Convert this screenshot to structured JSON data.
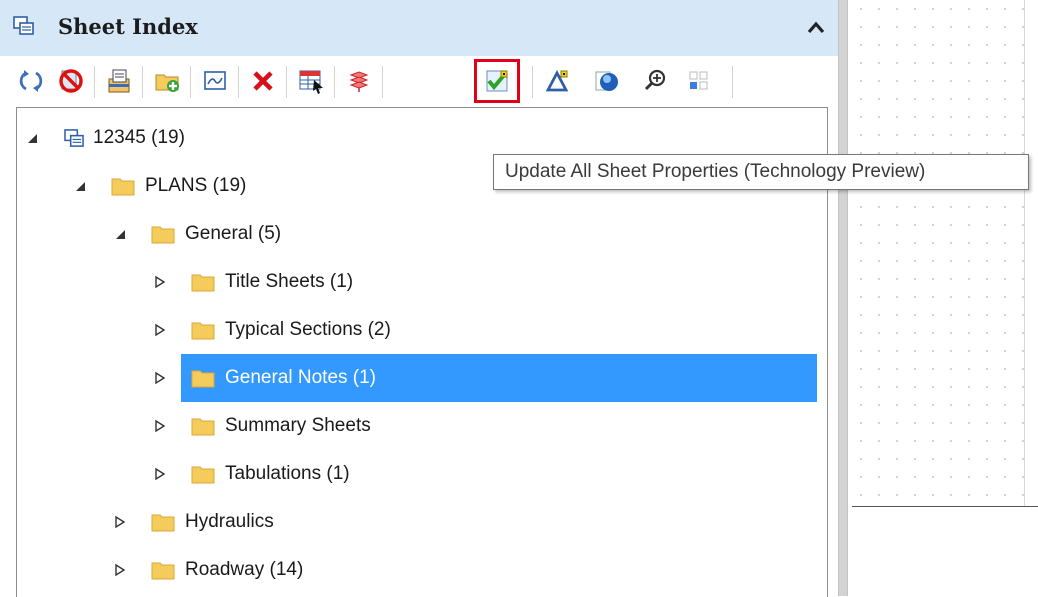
{
  "panel": {
    "title": "Sheet Index",
    "header_icon": "sheet-index-icon",
    "collapse_icon": "chevron-up-icon"
  },
  "toolbar": {
    "buttons": [
      {
        "name": "refresh-icon"
      },
      {
        "name": "no-entry-icon"
      },
      {
        "name": "sheet-stack-icon"
      },
      {
        "name": "add-folder-icon"
      },
      {
        "name": "sheet-image-icon"
      },
      {
        "name": "delete-icon"
      },
      {
        "name": "table-select-icon"
      },
      {
        "name": "layers-icon"
      },
      {
        "name": "update-properties-icon",
        "active": true
      },
      {
        "name": "triangle-icon"
      },
      {
        "name": "globe-icon"
      },
      {
        "name": "zoom-icon"
      },
      {
        "name": "grid-icon"
      }
    ]
  },
  "tooltip": {
    "text": "Update All Sheet Properties (Technology Preview)"
  },
  "tree": {
    "root": "12345 (19)",
    "plans": "PLANS (19)",
    "general": "General (5)",
    "title_sheets": "Title Sheets (1)",
    "typical_sections": "Typical Sections (2)",
    "general_notes": "General Notes (1)",
    "summary_sheets": "Summary Sheets",
    "tabulations": "Tabulations (1)",
    "hydraulics": "Hydraulics",
    "roadway": "Roadway (14)"
  },
  "colors": {
    "header_bg": "#d6e8f8",
    "selection": "#3399ff",
    "highlight_border": "#e0001b",
    "folder": "#f5cc5b"
  }
}
